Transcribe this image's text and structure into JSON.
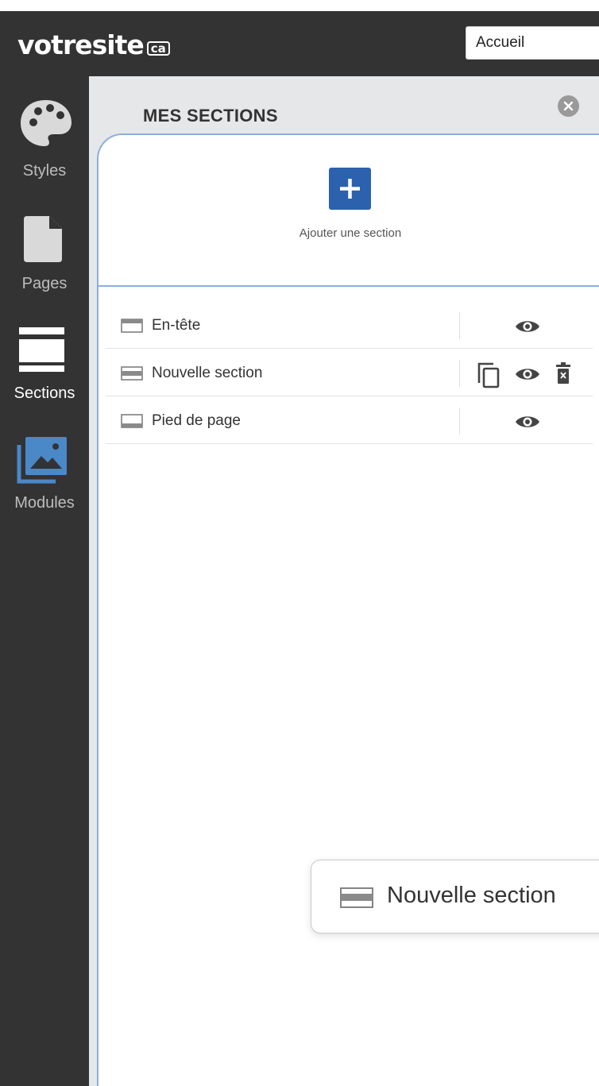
{
  "header": {
    "logo_text": "votresite",
    "logo_suffix": "ca",
    "page_select_value": "Accueil"
  },
  "sidebar": {
    "items": [
      {
        "label": "Styles",
        "icon": "palette-icon"
      },
      {
        "label": "Pages",
        "icon": "page-icon"
      },
      {
        "label": "Sections",
        "icon": "sections-icon",
        "active": true
      },
      {
        "label": "Modules",
        "icon": "image-icon"
      }
    ]
  },
  "panel": {
    "title": "MES SECTIONS",
    "add_label": "Ajouter une section",
    "rows": [
      {
        "label": "En-tête",
        "actions": [
          "eye-icon"
        ]
      },
      {
        "label": "Nouvelle section",
        "actions": [
          "copy-icon",
          "eye-icon",
          "trash-icon"
        ]
      },
      {
        "label": "Pied de page",
        "actions": [
          "eye-icon"
        ]
      }
    ]
  },
  "drag_ghost": {
    "label": "Nouvelle section"
  },
  "colors": {
    "dark": "#333333",
    "accent_blue": "#2b61ad",
    "panel_border": "#8ab0dc",
    "panel_bg": "#e6e7e9",
    "modules_icon": "#4a88c8"
  }
}
